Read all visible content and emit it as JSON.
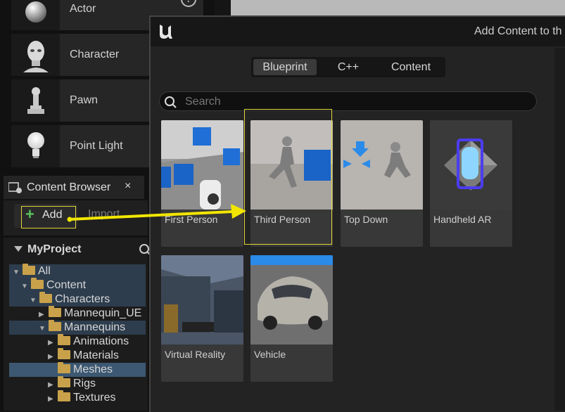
{
  "place_actors": {
    "items": [
      {
        "label": "Actor",
        "icon": "sphere-icon"
      },
      {
        "label": "Character",
        "icon": "mannequin-head-icon"
      },
      {
        "label": "Pawn",
        "icon": "pawn-icon"
      },
      {
        "label": "Point Light",
        "icon": "lightbulb-icon"
      }
    ],
    "help": "?"
  },
  "content_browser": {
    "tab_title": "Content Browser",
    "close": "×",
    "add_label": "Add",
    "import_label": "Import",
    "project": "MyProject",
    "tree": [
      {
        "label": "All",
        "depth": 0,
        "expanded": true
      },
      {
        "label": "Content",
        "depth": 1,
        "expanded": true
      },
      {
        "label": "Characters",
        "depth": 2,
        "expanded": true
      },
      {
        "label": "Mannequin_UE",
        "depth": 3,
        "expanded": false
      },
      {
        "label": "Mannequins",
        "depth": 3,
        "expanded": true
      },
      {
        "label": "Animations",
        "depth": 4,
        "expanded": false
      },
      {
        "label": "Materials",
        "depth": 4,
        "expanded": false
      },
      {
        "label": "Meshes",
        "depth": 4,
        "expanded": null,
        "selected": true
      },
      {
        "label": "Rigs",
        "depth": 4,
        "expanded": false
      },
      {
        "label": "Textures",
        "depth": 4,
        "expanded": false
      }
    ]
  },
  "dialog": {
    "title": "Add Content to th",
    "tabs": [
      "Blueprint",
      "C++",
      "Content"
    ],
    "active_tab": "Blueprint",
    "search_placeholder": "Search",
    "templates": [
      {
        "label": "First Person"
      },
      {
        "label": "Third Person",
        "highlighted": true
      },
      {
        "label": "Top Down"
      },
      {
        "label": "Handheld AR"
      },
      {
        "label": "Virtual Reality"
      },
      {
        "label": "Vehicle"
      }
    ]
  },
  "colors": {
    "highlight": "#e0d53a",
    "arrow": "#f2e600",
    "add_plus": "#5cc35c",
    "folder": "#c9a14a"
  }
}
